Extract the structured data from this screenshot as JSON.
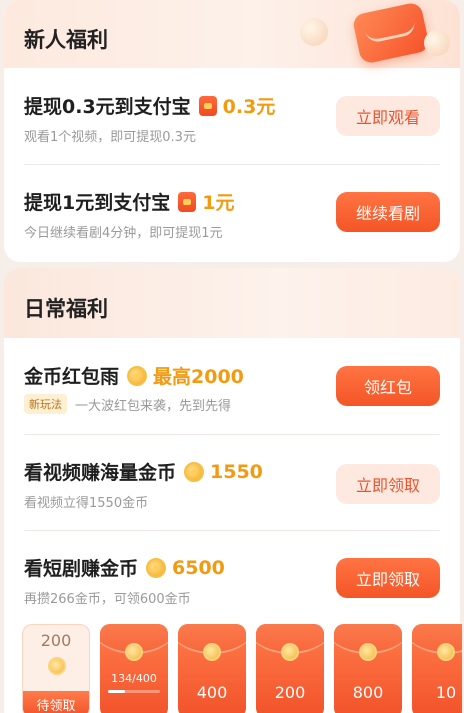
{
  "new_user": {
    "title": "新人福利",
    "tasks": [
      {
        "title": "提现0.3元到支付宝",
        "reward": "0.3元",
        "desc": "观看1个视频，即可提现0.3元",
        "button": "立即观看",
        "icon": "red-packet-icon"
      },
      {
        "title": "提现1元到支付宝",
        "reward": "1元",
        "desc": "今日继续看剧4分钟，即可提现1元",
        "button": "继续看剧",
        "icon": "red-packet-icon"
      }
    ]
  },
  "daily": {
    "title": "日常福利",
    "tasks": [
      {
        "title": "金币红包雨",
        "reward": "最高2000",
        "tag": "新玩法",
        "desc": "一大波红包来袭，先到先得",
        "button": "领红包",
        "icon": "coin-icon"
      },
      {
        "title": "看视频赚海量金币",
        "reward": "1550",
        "desc": "看视频立得1550金币",
        "button": "立即领取",
        "icon": "coin-icon"
      },
      {
        "title": "看短剧赚金币",
        "reward": "6500",
        "desc": "再攒266金币，可领600金币",
        "button": "立即领取",
        "icon": "coin-icon"
      }
    ],
    "coin_tiles": [
      {
        "value": "200",
        "status": "待领取"
      },
      {
        "progress_text": "134/400",
        "progress": 0.335
      },
      {
        "value": "400"
      },
      {
        "value": "200"
      },
      {
        "value": "800"
      },
      {
        "value": "10"
      }
    ]
  },
  "colors": {
    "accent": "#f45526",
    "reward": "#f29b11",
    "button_light_bg": "#fde9e0"
  }
}
